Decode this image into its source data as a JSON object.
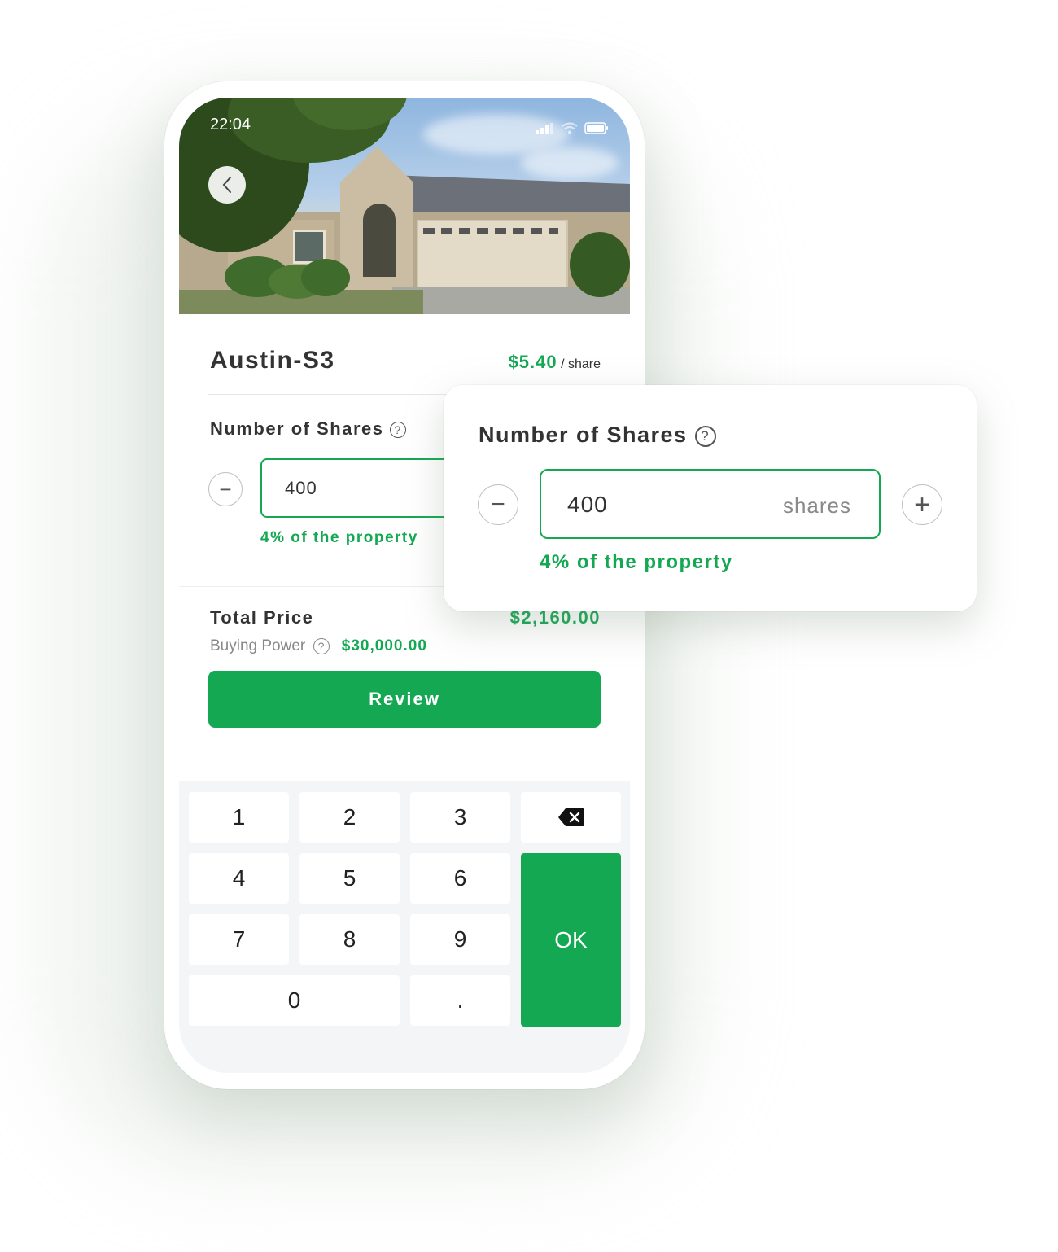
{
  "status_bar": {
    "time": "22:04"
  },
  "property": {
    "name": "Austin-S3",
    "price": "$5.40",
    "price_unit": "/ share"
  },
  "shares": {
    "label": "Number of Shares",
    "help": "?",
    "value": "400",
    "unit": "shares",
    "percent_text": "4% of the property",
    "decrement": "−",
    "increment": "+"
  },
  "total": {
    "label": "Total Price",
    "value": "$2,160.00",
    "buying_power_label": "Buying Power",
    "buying_power_value": "$30,000.00"
  },
  "review_button": "Review",
  "keypad": {
    "keys": [
      "1",
      "2",
      "3",
      "4",
      "5",
      "6",
      "7",
      "8",
      "9",
      "0",
      "."
    ],
    "ok": "OK",
    "backspace_icon": "backspace-icon"
  },
  "colors": {
    "accent": "#14a853",
    "keypad_bg": "#f4f5f7"
  }
}
